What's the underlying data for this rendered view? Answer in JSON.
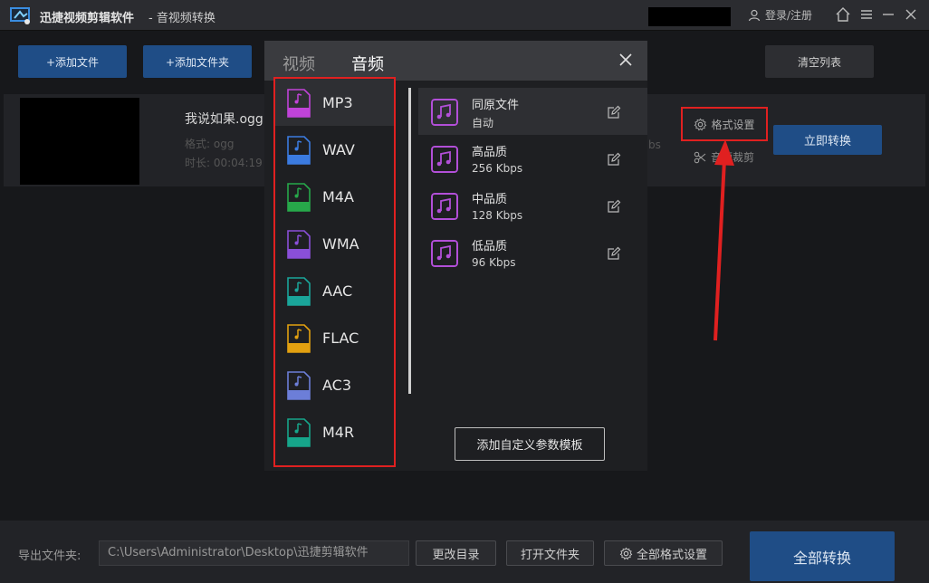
{
  "titlebar": {
    "app_name": "迅捷视频剪辑软件",
    "subtitle": "- 音视频转换",
    "login": "登录/注册"
  },
  "toolbar": {
    "add_file": "+添加文件",
    "add_folder": "+添加文件夹",
    "clear_list": "清空列表"
  },
  "file": {
    "name": "我说如果.ogg",
    "format": "格式: ogg",
    "duration": "时长: 00:04:19",
    "bitrate_partial": "bs",
    "format_setting": "格式设置",
    "trim": "音频裁剪",
    "convert_now": "立即转换"
  },
  "popup": {
    "tabs": [
      "视频",
      "音频"
    ],
    "active_tab": "音频",
    "formats": [
      {
        "label": "MP3",
        "color": "#c043d8"
      },
      {
        "label": "WAV",
        "color": "#3b7be0"
      },
      {
        "label": "M4A",
        "color": "#27a84a"
      },
      {
        "label": "WMA",
        "color": "#8a4fd8"
      },
      {
        "label": "AAC",
        "color": "#1aa59a"
      },
      {
        "label": "FLAC",
        "color": "#e2a010"
      },
      {
        "label": "AC3",
        "color": "#6c7ed8"
      },
      {
        "label": "M4R",
        "color": "#16a58a"
      }
    ],
    "qualities": [
      {
        "name": "同原文件",
        "desc": "自动"
      },
      {
        "name": "高品质",
        "desc": "256 Kbps"
      },
      {
        "name": "中品质",
        "desc": "128 Kbps"
      },
      {
        "name": "低品质",
        "desc": "96 Kbps"
      }
    ],
    "add_template": "添加自定义参数模板"
  },
  "bottom": {
    "output_label": "导出文件夹:",
    "output_path": "C:\\Users\\Administrator\\Desktop\\迅捷剪辑软件",
    "change_dir": "更改目录",
    "open_folder": "打开文件夹",
    "all_format": "全部格式设置",
    "convert_all": "全部转换"
  },
  "colors": {
    "accent_blue": "#1f4d86",
    "highlight_red": "#e02020",
    "music_purple": "#b24fd8"
  }
}
